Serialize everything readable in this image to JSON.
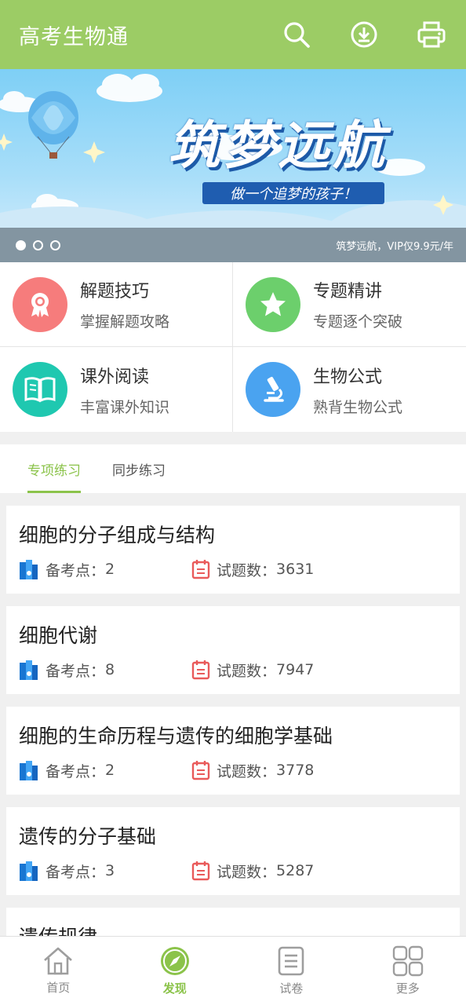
{
  "header": {
    "title": "高考生物通",
    "icons": [
      "search-icon",
      "download-icon",
      "print-icon"
    ]
  },
  "banner": {
    "headline": "筑梦远航",
    "subtitle": "做一个追梦的孩子！",
    "caption": "筑梦远航，VIP仅9.9元/年",
    "dot_count": 3,
    "active_dot": 0
  },
  "features": [
    {
      "title": "解题技巧",
      "desc": "掌握解题攻略",
      "icon": "badge-icon",
      "color": "#f67c7c"
    },
    {
      "title": "专题精讲",
      "desc": "专题逐个突破",
      "icon": "star-icon",
      "color": "#6ccf6c"
    },
    {
      "title": "课外阅读",
      "desc": "丰富课外知识",
      "icon": "book-icon",
      "color": "#1fc8b0"
    },
    {
      "title": "生物公式",
      "desc": "熟背生物公式",
      "icon": "microscope-icon",
      "color": "#4aa3f0"
    }
  ],
  "tabs": [
    {
      "label": "专项练习",
      "active": true
    },
    {
      "label": "同步练习",
      "active": false
    }
  ],
  "list": {
    "points_label": "备考点：",
    "questions_label": "试题数：",
    "items": [
      {
        "title": "细胞的分子组成与结构",
        "points": "2",
        "questions": "3631"
      },
      {
        "title": "细胞代谢",
        "points": "8",
        "questions": "7947"
      },
      {
        "title": "细胞的生命历程与遗传的细胞学基础",
        "points": "2",
        "questions": "3778"
      },
      {
        "title": "遗传的分子基础",
        "points": "3",
        "questions": "5287"
      },
      {
        "title": "遗传规律",
        "points": "",
        "questions": ""
      }
    ]
  },
  "bottom_nav": [
    {
      "label": "首页",
      "icon": "home-icon",
      "active": false
    },
    {
      "label": "发现",
      "icon": "compass-icon",
      "active": true
    },
    {
      "label": "试卷",
      "icon": "paper-icon",
      "active": false
    },
    {
      "label": "更多",
      "icon": "grid-icon",
      "active": false
    }
  ],
  "colors": {
    "accent": "#9ccc65",
    "active": "#8bc34a",
    "banner_blue": "#1f5db0"
  }
}
